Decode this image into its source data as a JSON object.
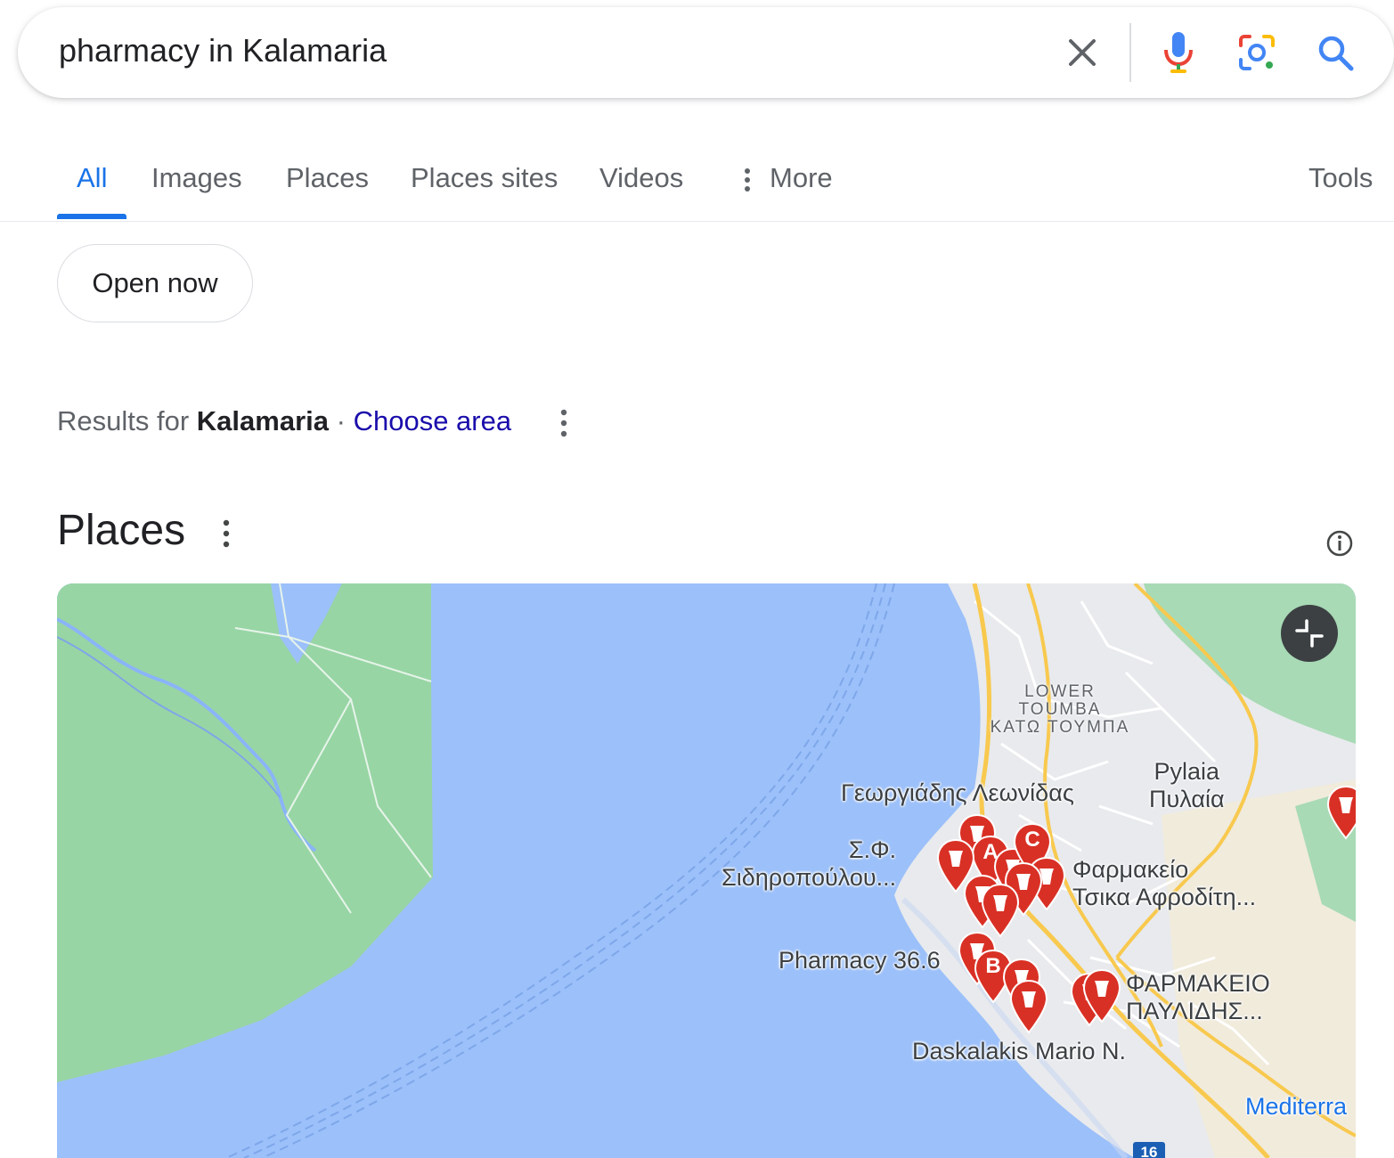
{
  "search": {
    "query": "pharmacy in Kalamaria",
    "clear_icon": "close-icon",
    "voice_icon": "microphone-icon",
    "lens_icon": "camera-lens-icon",
    "search_icon": "search-icon"
  },
  "tabs": [
    {
      "label": "All",
      "active": true
    },
    {
      "label": "Images"
    },
    {
      "label": "Places"
    },
    {
      "label": "Places sites"
    },
    {
      "label": "Videos"
    },
    {
      "label": "More"
    }
  ],
  "tools_label": "Tools",
  "filters": {
    "open_now": "Open now"
  },
  "results_for": {
    "prefix": "Results for",
    "location": "Kalamaria",
    "separator": "·",
    "choose_area": "Choose area"
  },
  "places": {
    "title": "Places"
  },
  "map": {
    "labels": {
      "lower_toumba": "LOWER\nTOUMBA\nΚΑΤΩ ΤΟΥΜΠΑ",
      "pylaia": "Pylaia\nΠυλαία",
      "georgiadis": "Γεωργιάδης Λεωνίδας",
      "sidiropoulou": "Σ.Φ.\nΣιδηροπούλου...",
      "farmakeio_tsika": "Φαρμακείο\nΤσικα Αφροδίτη...",
      "pharmacy_366": "Pharmacy 36.6",
      "farmakeio_pavlidis": "ΦΑΡΜΑΚΕΙΟ\nΠΑΥΛΙΔΗΣ...",
      "daskalakis": "Daskalakis Mario N.",
      "mediterranean": "Mediterra",
      "route": "16"
    },
    "pin_letters": [
      "A",
      "B",
      "C"
    ],
    "colors": {
      "water": "#9cc0f9",
      "land": "#98d5a4",
      "urban": "#e8eaed",
      "pin": "#d93025",
      "road": "#f8c94e"
    }
  }
}
